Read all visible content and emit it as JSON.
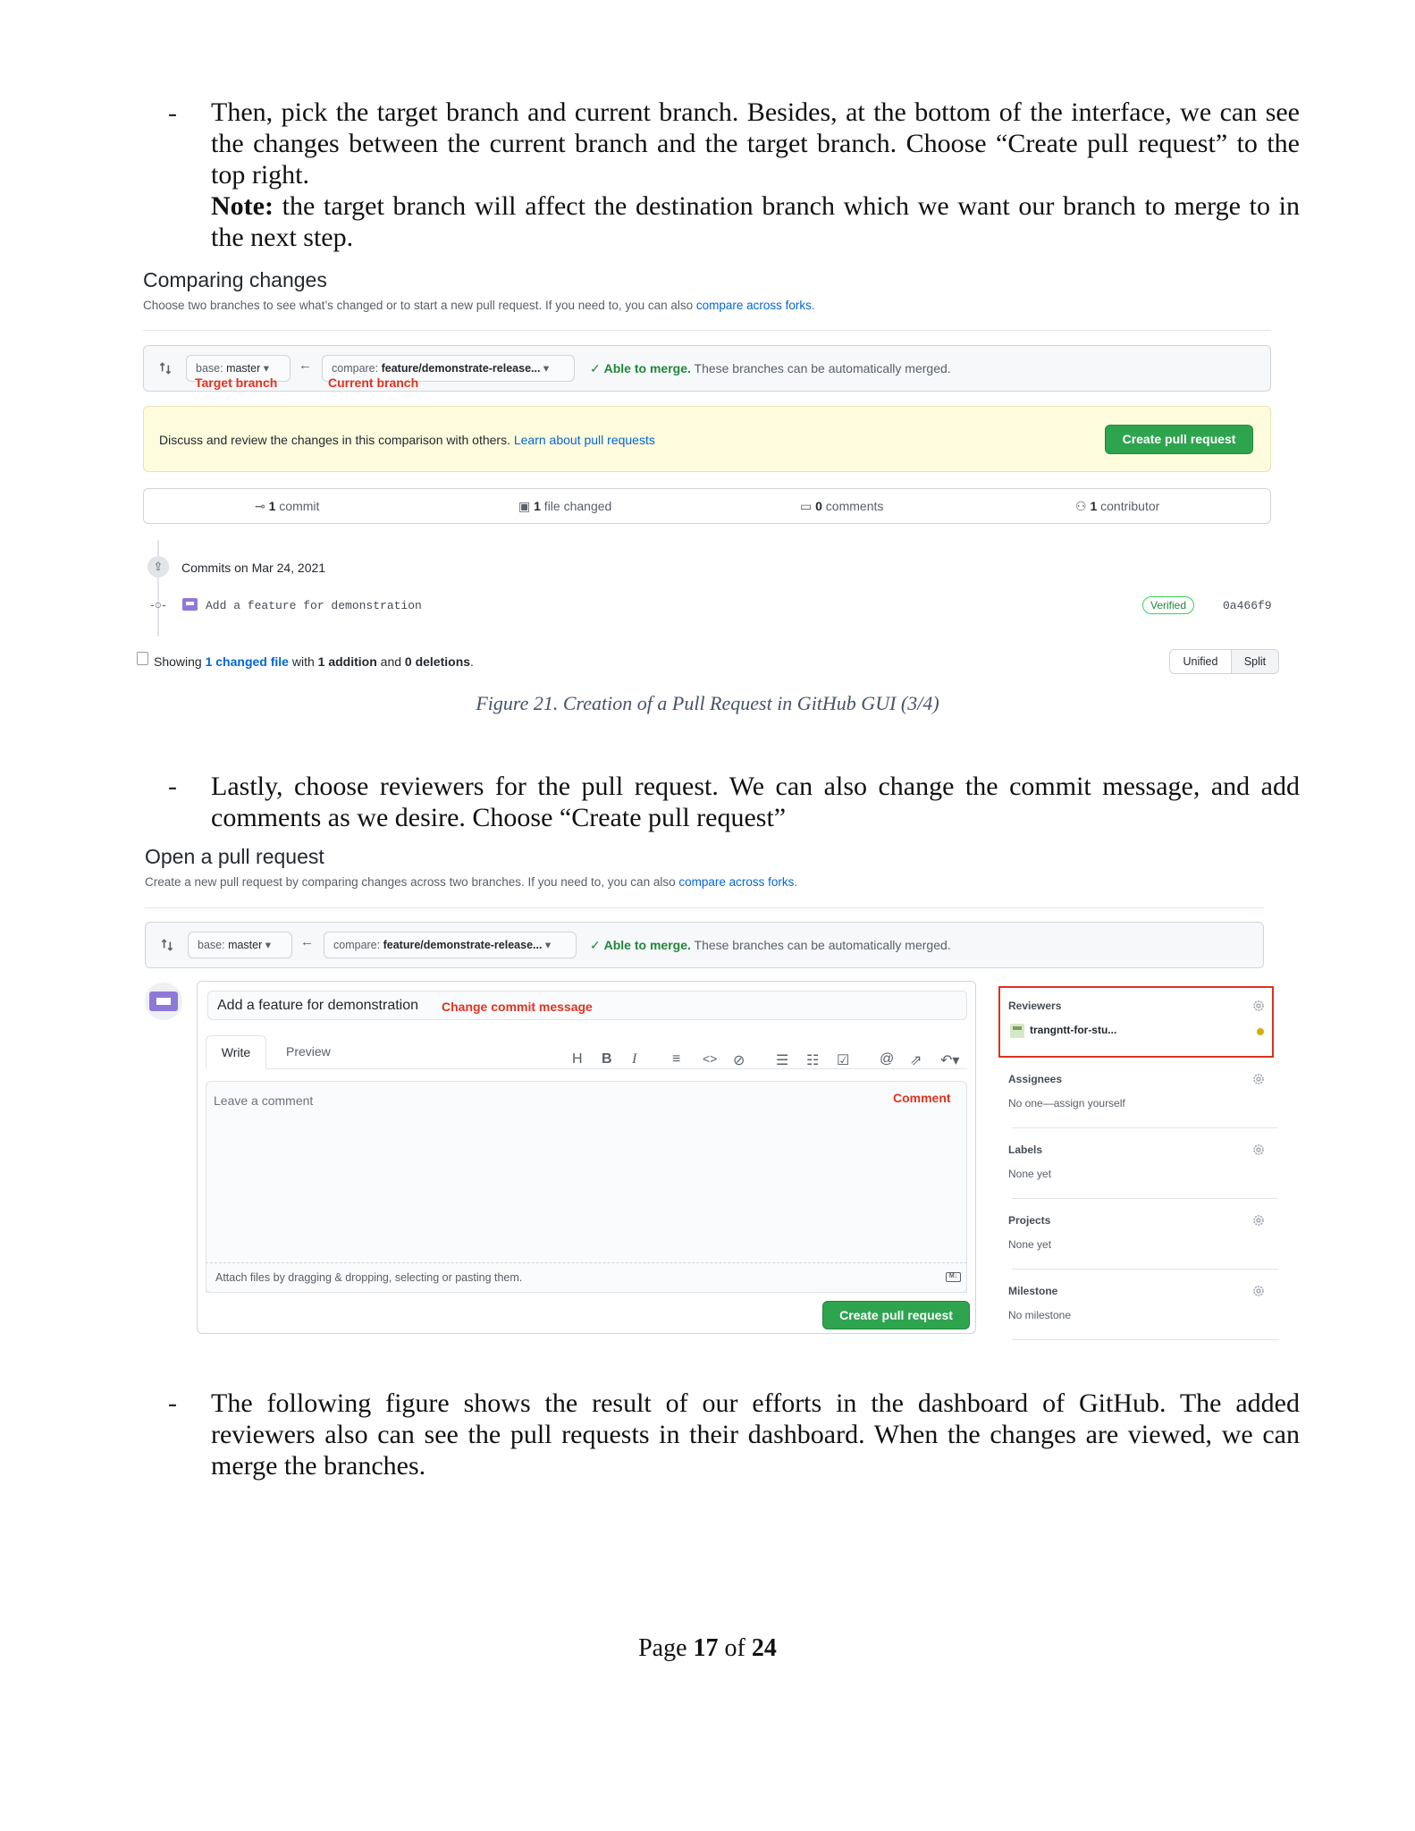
{
  "bullet": "-",
  "para1": {
    "line1": "Then, pick the target branch and current branch. Besides, at the bottom of the interface, we can see",
    "line2": "the changes between the current branch and the target branch. Choose “Create pull request” to the",
    "line3": "top right.",
    "note_label": "Note:",
    "note_text": " the target branch will affect the destination branch which we want our branch to merge to in",
    "note_line2": "the next step."
  },
  "fig1": {
    "title": "Comparing changes",
    "subtitle": "Choose two branches to see what’s changed or to start a new pull request. If you need to, you can also ",
    "subtitle_link": "compare across forks",
    "subtitle_end": ".",
    "base_prefix": "base: ",
    "base_value": "master",
    "compare_prefix": "compare: ",
    "compare_value": "feature/demonstrate-release...",
    "merge_ok": "Able to merge.",
    "merge_text": " These branches can be automatically merged.",
    "target_label": "Target branch",
    "current_label": "Current branch",
    "discuss": "Discuss and review the changes in this comparison with others. ",
    "discuss_link": "Learn about pull requests",
    "create_btn": "Create pull request",
    "stats": [
      {
        "num": "1",
        "label": " commit"
      },
      {
        "num": "1",
        "label": " file changed"
      },
      {
        "num": "0",
        "label": " comments"
      },
      {
        "num": "1",
        "label": " contributor"
      }
    ],
    "commits_on": "Commits on Mar 24, 2021",
    "commit_msg": "Add a feature for demonstration",
    "verified": "Verified",
    "sha": "0a466f9",
    "showing": "Showing ",
    "changed_file": "1 changed file",
    "with": " with ",
    "addition": "1 addition",
    "and": " and ",
    "deletions": "0 deletions",
    "period": ".",
    "unified": "Unified",
    "split": "Split",
    "caption": "Figure 21. Creation of a Pull Request in GitHub GUI (3/4)"
  },
  "para2": {
    "line1": "Lastly, choose reviewers for the pull request. We can also change the commit message, and add",
    "line2": "comments as we desire. Choose “Create pull request”"
  },
  "fig2": {
    "title": "Open a pull request",
    "subtitle": "Create a new pull request by comparing changes across two branches. If you need to, you can also ",
    "subtitle_link": "compare across forks",
    "subtitle_end": ".",
    "base_prefix": "base: ",
    "base_value": "master",
    "compare_prefix": "compare: ",
    "compare_value": "feature/demonstrate-release...",
    "merge_ok": "Able to merge.",
    "merge_text": " These branches can be automatically merged.",
    "title_input": "Add a feature for demonstration",
    "change_commit": "Change commit message",
    "tab_write": "Write",
    "tab_preview": "Preview",
    "comment_placeholder": "Leave a comment",
    "comment_label": "Comment",
    "attach": "Attach files by dragging & dropping, selecting or pasting them.",
    "create_btn": "Create pull request",
    "sidebar": {
      "reviewers": "Reviewers",
      "reviewer_name": "trangntt-for-stu...",
      "assignees": "Assignees",
      "assignees_val": "No one—assign yourself",
      "labels": "Labels",
      "labels_val": "None yet",
      "projects": "Projects",
      "projects_val": "None yet",
      "milestone": "Milestone",
      "milestone_val": "No milestone"
    }
  },
  "para3": {
    "line1": "The following figure shows the result of our efforts in the dashboard of GitHub. The added",
    "line2": "reviewers also can see the pull requests in their dashboard. When the changes are viewed, we can",
    "line3": "merge the branches."
  },
  "footer": {
    "page": "Page ",
    "num": "17",
    "of": " of ",
    "total": "24"
  },
  "colors": {
    "green": "#2ea44f",
    "link": "#0366d6",
    "annotation_red": "#e0321f",
    "banner": "#fffbdd"
  }
}
